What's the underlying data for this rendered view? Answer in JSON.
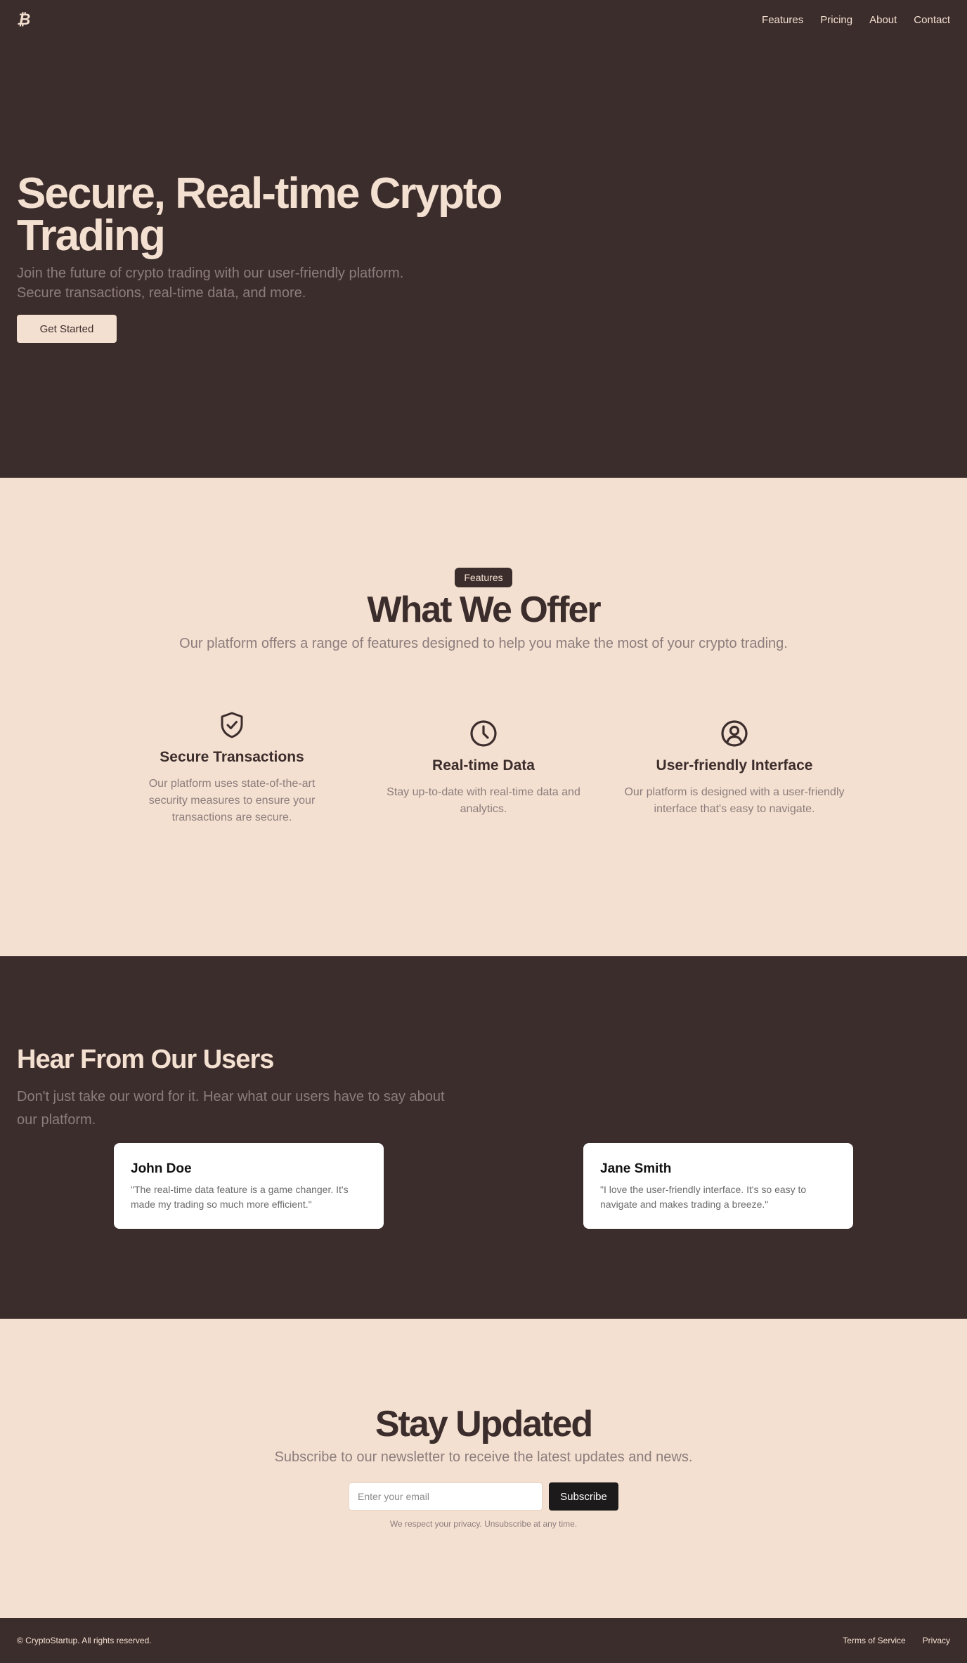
{
  "header": {
    "logo_glyph": "₿",
    "nav": [
      "Features",
      "Pricing",
      "About",
      "Contact"
    ]
  },
  "hero": {
    "title": "Secure, Real-time Crypto Trading",
    "subtitle": "Join the future of crypto trading with our user-friendly platform. Secure transactions, real-time data, and more.",
    "cta": "Get Started"
  },
  "features": {
    "pill": "Features",
    "title": "What We Offer",
    "subtitle": "Our platform offers a range of features designed to help you make the most of your crypto trading.",
    "items": [
      {
        "icon": "shield-check-icon",
        "title": "Secure Transactions",
        "text": "Our platform uses state-of-the-art security measures to ensure your transactions are secure."
      },
      {
        "icon": "clock-icon",
        "title": "Real-time Data",
        "text": "Stay up-to-date with real-time data and analytics."
      },
      {
        "icon": "user-circle-icon",
        "title": "User-friendly Interface",
        "text": "Our platform is designed with a user-friendly interface that's easy to navigate."
      }
    ]
  },
  "testimonials": {
    "title": "Hear From Our Users",
    "subtitle": "Don't just take our word for it. Hear what our users have to say about our platform.",
    "items": [
      {
        "name": "John Doe",
        "quote": "\"The real-time data feature is a game changer. It's made my trading so much more efficient.\""
      },
      {
        "name": "Jane Smith",
        "quote": "\"I love the user-friendly interface. It's so easy to navigate and makes trading a breeze.\""
      }
    ]
  },
  "newsletter": {
    "title": "Stay Updated",
    "subtitle": "Subscribe to our newsletter to receive the latest updates and news.",
    "email_placeholder": "Enter your email",
    "button": "Subscribe",
    "privacy": "We respect your privacy. Unsubscribe at any time."
  },
  "footer": {
    "copyright": "© CryptoStartup. All rights reserved.",
    "links": [
      "Terms of Service",
      "Privacy"
    ]
  },
  "colors": {
    "dark": "#3c2d2d",
    "light": "#f4e0d0",
    "muted": "#8c7d7d"
  }
}
